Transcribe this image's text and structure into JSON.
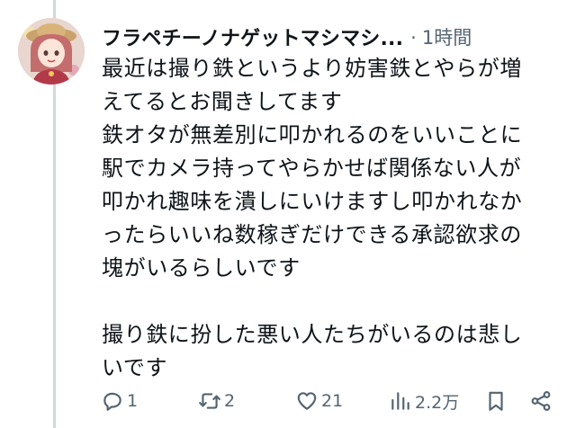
{
  "tweet": {
    "display_name": "フラペチーノナゲットマシマシ...",
    "separator": "·",
    "time_ago": "1時間",
    "text_lines_1": [
      "最近は撮り鉄というより妨害鉄とやらが増",
      "えてるとお聞きしてます",
      "鉄オタが無差別に叩かれるのをいいことに",
      "駅でカメラ持ってやらかせば関係ない人が",
      "叩かれ趣味を潰しにいけますし叩かれなか",
      "ったらいいね数稼ぎだけできる承認欲求の",
      "塊がいるらしいです"
    ],
    "text_lines_2": [
      "撮り鉄に扮した悪い人たちがいるのは悲し",
      "いです"
    ]
  },
  "actions": {
    "reply_count": "1",
    "retweet_count": "2",
    "like_count": "21",
    "view_count": "2.2万"
  },
  "icons": {
    "reply": "reply-icon",
    "retweet": "retweet-icon",
    "like": "heart-icon",
    "views": "views-icon",
    "bookmark": "bookmark-icon",
    "share": "share-icon"
  },
  "colors": {
    "text": "#0f1419",
    "secondary": "#536471",
    "thread_line": "#cfd9de"
  }
}
